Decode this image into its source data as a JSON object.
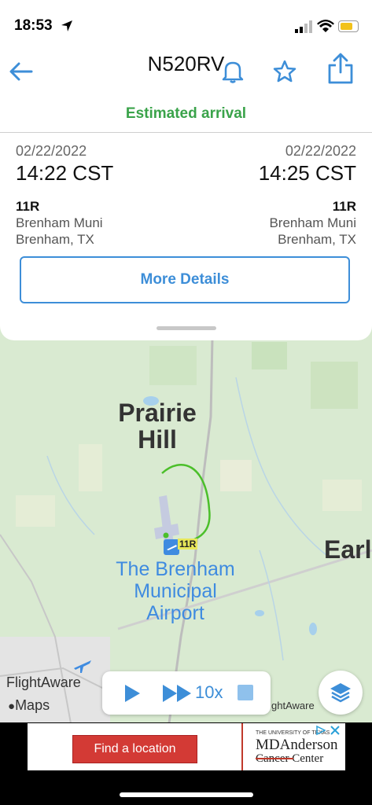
{
  "status": {
    "time": "18:53"
  },
  "header": {
    "title": "N520RV",
    "status_text": "Estimated arrival",
    "status_color": "#3aa34a"
  },
  "flight": {
    "departure": {
      "date": "02/22/2022",
      "time": "14:22 CST",
      "code": "11R",
      "airport": "Brenham Muni",
      "city": "Brenham, TX"
    },
    "arrival": {
      "date": "02/22/2022",
      "time": "14:25 CST",
      "code": "11R",
      "airport": "Brenham Muni",
      "city": "Brenham, TX"
    },
    "more_details_label": "More Details"
  },
  "map": {
    "labels": {
      "prairie": "Prairie",
      "hill": "Hill",
      "earl": "Earl",
      "airport_line1": "The Brenham",
      "airport_line2": "Municipal",
      "airport_line3": "Airport",
      "marker_code": "11R"
    },
    "attribution": {
      "flightaware": "FlightAware",
      "maps": "Maps",
      "flightaware_partial": "ghtAware"
    },
    "playback": {
      "speed": "10x"
    }
  },
  "ad": {
    "button_label": "Find a location",
    "brand_small": "THE UNIVERSITY OF TEXAS",
    "brand_line1": "MDAnderson",
    "brand_line2": "Cancer Center"
  },
  "colors": {
    "accent": "#3d8ed8",
    "track": "#4bbf2a",
    "map_bg": "#d9ead1"
  },
  "icons": [
    "back-arrow-icon",
    "bell-icon",
    "star-icon",
    "share-icon",
    "play-icon",
    "fast-forward-icon",
    "stop-icon",
    "layers-icon",
    "plane-icon",
    "close-icon"
  ]
}
